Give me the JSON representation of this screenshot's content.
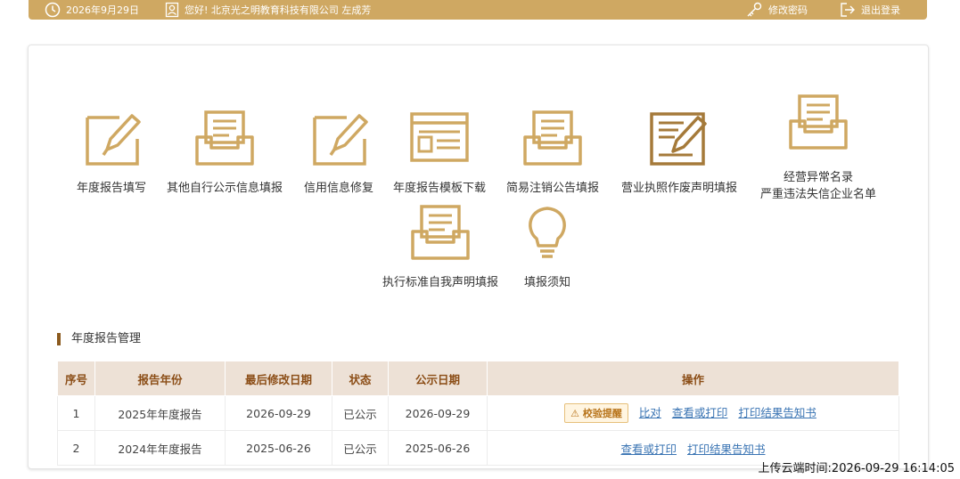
{
  "topbar": {
    "date": "2026年9月29日",
    "greeting": "您好! 北京光之明教育科技有限公司  左成芳",
    "change_password": "修改密码",
    "logout": "退出登录"
  },
  "tiles": [
    {
      "label": "年度报告填写",
      "icon": "edit-pen-icon"
    },
    {
      "label": "其他自行公示信息填报",
      "icon": "inbox-tray-icon"
    },
    {
      "label": "信用信息修复",
      "icon": "edit-pen-icon"
    },
    {
      "label": "年度报告模板下载",
      "icon": "template-icon"
    },
    {
      "label": "简易注销公告填报",
      "icon": "inbox-tray-icon"
    },
    {
      "label": "营业执照作废声明填报",
      "icon": "document-edit-icon"
    },
    {
      "label": "经营异常名录",
      "label2": "严重违法失信企业名单",
      "icon": "inbox-tray-icon"
    },
    {
      "label": "执行标准自我声明填报",
      "icon": "inbox-tray-icon"
    },
    {
      "label": "填报须知",
      "icon": "lightbulb-icon"
    }
  ],
  "section": {
    "title": "年度报告管理"
  },
  "table": {
    "headers": [
      "序号",
      "报告年份",
      "最后修改日期",
      "状态",
      "公示日期",
      "操作"
    ],
    "rows": [
      {
        "no": "1",
        "year": "2025年年度报告",
        "modified": "2026-09-29",
        "status": "已公示",
        "published": "2026-09-29",
        "warn": "校验提醒",
        "compare": "比对",
        "view": "查看或打印",
        "print": "打印结果告知书"
      },
      {
        "no": "2",
        "year": "2024年年度报告",
        "modified": "2025-06-26",
        "status": "已公示",
        "published": "2025-06-26",
        "view": "查看或打印",
        "print": "打印结果告知书"
      }
    ]
  },
  "footer": {
    "upload_time": "上传云端时间:2026-09-29 16:14:05"
  },
  "colors": {
    "gold": "#cfa862",
    "header_bg": "#ede1d6",
    "link": "#3a74b3"
  }
}
